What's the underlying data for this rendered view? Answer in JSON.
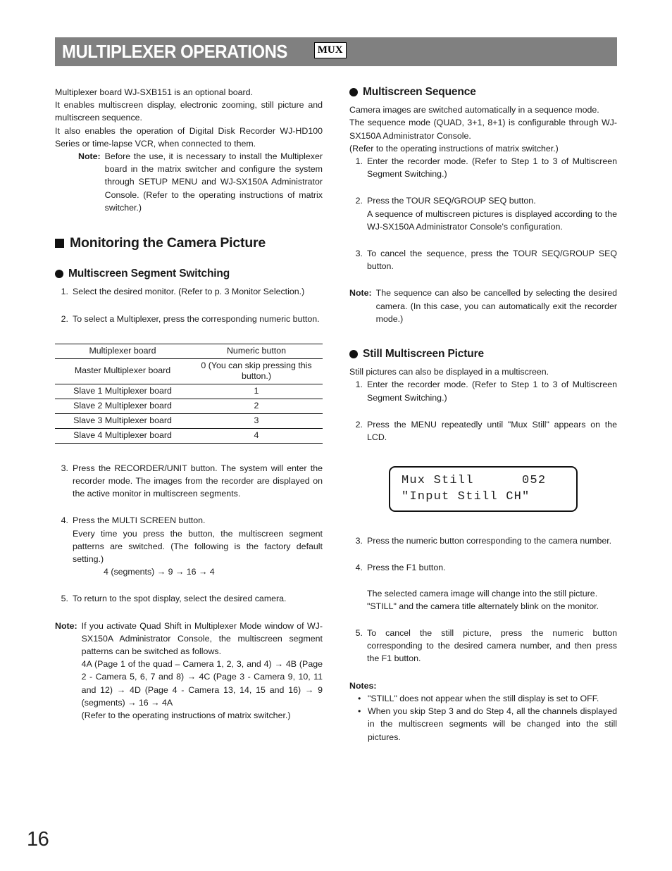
{
  "header": {
    "title": "MULTIPLEXER OPERATIONS",
    "badge": "MUX"
  },
  "page_number": "16",
  "left_column": {
    "intro": {
      "line1": "Multiplexer board WJ-SXB151 is an optional board.",
      "line2": "It enables multiscreen display, electronic zooming, still picture and multiscreen sequence.",
      "line3": "It also enables the operation of Digital Disk Recorder WJ-HD100 Series or time-lapse VCR, when connected to them."
    },
    "intro_note": {
      "label": "Note:",
      "text": "Before the use, it is necessary to install the Multiplexer board in the matrix switcher and configure the system through SETUP MENU and WJ-SX150A Administrator Console. (Refer to the operating instructions of matrix switcher.)"
    },
    "section_heading": "Monitoring the Camera Picture",
    "sub_heading": "Multiscreen Segment Switching",
    "steps": [
      {
        "num": "1.",
        "text": "Select the desired monitor. (Refer to p. 3 Monitor Selection.)"
      },
      {
        "num": "2.",
        "text": "To select a Multiplexer, press the corresponding numeric button."
      },
      {
        "num": "3.",
        "text": "Press the RECORDER/UNIT button. The system will enter the recorder mode. The images from the recorder are displayed on the active monitor in multiscreen segments."
      }
    ],
    "table": {
      "headers": [
        "Multiplexer board",
        "Numeric button"
      ],
      "rows": [
        [
          "Master Multiplexer board",
          "0 (You can skip pressing this button.)"
        ],
        [
          "Slave 1 Multiplexer board",
          "1"
        ],
        [
          "Slave 2 Multiplexer board",
          "2"
        ],
        [
          "Slave 3 Multiplexer board",
          "3"
        ],
        [
          "Slave 4 Multiplexer board",
          "4"
        ]
      ]
    },
    "step4": {
      "num": "4.",
      "line1": "Press the MULTI SCREEN button.",
      "line2": "Every time you press the button, the multiscreen segment patterns are switched. (The following is the factory default setting.)",
      "sequence": "4 (segments) → 9 → 16 → 4"
    },
    "step5": {
      "num": "5.",
      "text": "To return to the spot display, select the desired camera."
    },
    "final_note": {
      "label": "Note:",
      "text": "If you activate Quad Shift in Multiplexer Mode window of WJ-SX150A Administrator Console, the multiscreen segment patterns can be switched as follows.",
      "sequence": "4A (Page 1 of the quad – Camera 1, 2, 3, and 4) → 4B (Page 2 - Camera 5, 6, 7 and 8) → 4C (Page 3 - Camera 9, 10, 11 and 12) → 4D (Page 4 - Camera 13, 14, 15 and 16) → 9 (segments) → 16 → 4A",
      "refer": "(Refer to the operating instructions of matrix switcher.)"
    }
  },
  "right_column": {
    "seq_heading": "Multiscreen Sequence",
    "seq_intro": {
      "line1": "Camera images are switched automatically in a sequence mode.",
      "line2": "The sequence mode (QUAD, 3+1, 8+1) is configurable through WJ-SX150A Administrator Console.",
      "line3": "(Refer to the operating instructions of matrix switcher.)"
    },
    "seq_steps": [
      {
        "num": "1.",
        "text": "Enter the recorder mode. (Refer to Step 1 to 3 of Multiscreen Segment Switching.)"
      },
      {
        "num": "2.",
        "line1": "Press the TOUR SEQ/GROUP SEQ button.",
        "line2": "A sequence of multiscreen pictures is displayed according to the WJ-SX150A Administrator Console's configuration."
      },
      {
        "num": "3.",
        "text": "To cancel the sequence, press the TOUR SEQ/GROUP SEQ button."
      }
    ],
    "seq_note": {
      "label": "Note:",
      "text": "The sequence can also be cancelled by selecting the desired camera. (In this case, you can automatically exit the recorder mode.)"
    },
    "still_heading": "Still Multiscreen Picture",
    "still_intro": "Still pictures can also be displayed in a multiscreen.",
    "still_steps": [
      {
        "num": "1.",
        "text": "Enter the recorder mode. (Refer to Step 1 to 3 of Multiscreen Segment Switching.)"
      },
      {
        "num": "2.",
        "text": "Press the MENU repeatedly until \"Mux Still\" appears on the LCD."
      }
    ],
    "lcd": {
      "line1": "Mux Still      052",
      "line2": "\"Input Still CH\""
    },
    "still_steps_cont": [
      {
        "num": "3.",
        "text": "Press the numeric button corresponding to the camera number."
      },
      {
        "num": "4.",
        "line1": "Press the F1 button.",
        "line2": "The selected camera image will change into the still picture.",
        "line3": "\"STILL\" and the camera title alternately blink on the monitor."
      },
      {
        "num": "5.",
        "text": "To cancel the still picture, press the numeric button corresponding to the desired camera number, and then press the F1 button."
      }
    ],
    "notes_title": "Notes:",
    "notes": [
      "\"STILL\" does not appear when the still display is set to OFF.",
      "When you skip Step 3 and do Step 4, all the channels displayed in the multiscreen segments will be changed into the still pictures."
    ]
  }
}
